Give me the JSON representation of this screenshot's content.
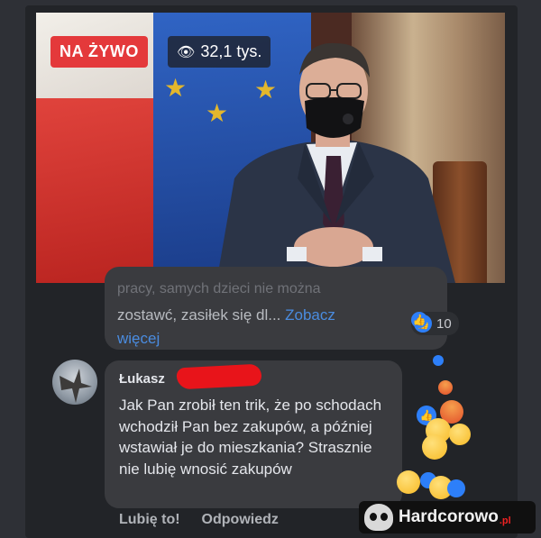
{
  "live": {
    "badge_label": "NA ŻYWO",
    "viewers": "32,1 tys.",
    "viewer_icon": "eye-icon"
  },
  "previous_comment": {
    "faded_line": "pracy, samych dzieci nie można",
    "line": "zostawć, zasiłek się dl... ",
    "see_more": "Zobacz",
    "see_more_cont": "więcej",
    "reaction_count": "10"
  },
  "comment": {
    "author": "Łukasz",
    "text": "Jak Pan zrobił ten trik, że po schodach wchodził Pan bez zakupów, a później wstawiał je do mieszkania? Strasznie nie lubię wnosić zakupów",
    "like_action": "Lubię to!",
    "reply_action": "Odpowiedz"
  },
  "watermark": {
    "name": "Hardcorowo",
    "suffix": ".pl"
  },
  "colors": {
    "live_red": "#e4393b",
    "link_blue": "#4a8ce0",
    "bubble": "#3a3b3f",
    "background": "#2e3036"
  }
}
